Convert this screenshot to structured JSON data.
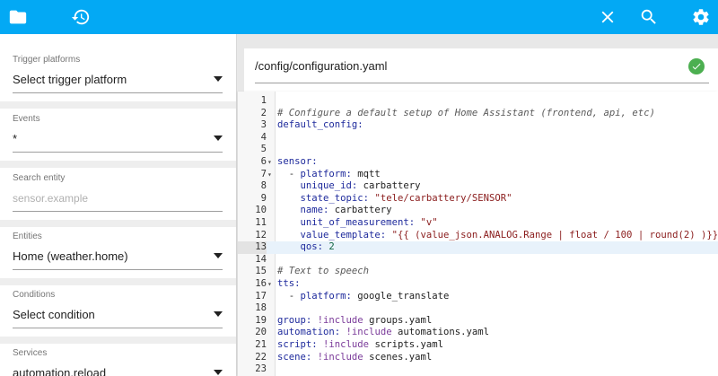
{
  "toolbar": {
    "icons": [
      "folder-icon",
      "history-icon",
      "close-icon",
      "search-icon",
      "settings-icon"
    ],
    "color": "#03a9f4"
  },
  "sidebar": {
    "trigger_platforms": {
      "label": "Trigger platforms",
      "value": "Select trigger platform"
    },
    "events": {
      "label": "Events",
      "value": "*"
    },
    "search_entity": {
      "label": "Search entity",
      "placeholder": "sensor.example"
    },
    "entities": {
      "label": "Entities",
      "value": "Home (weather.home)"
    },
    "conditions": {
      "label": "Conditions",
      "value": "Select condition"
    },
    "services": {
      "label": "Services",
      "value": "automation.reload"
    }
  },
  "editor": {
    "file_path": "/config/configuration.yaml",
    "status": "saved-ok",
    "active_line": 13,
    "lines": [
      {
        "n": "1",
        "fold": "",
        "segs": []
      },
      {
        "n": "2",
        "fold": "",
        "segs": [
          [
            "c-comment",
            "# Configure a default setup of Home Assistant (frontend, api, etc)"
          ]
        ]
      },
      {
        "n": "3",
        "fold": "",
        "segs": [
          [
            "c-key",
            "default_config:"
          ]
        ]
      },
      {
        "n": "4",
        "fold": "",
        "segs": []
      },
      {
        "n": "5",
        "fold": "",
        "segs": []
      },
      {
        "n": "6",
        "fold": "▾",
        "segs": [
          [
            "c-key",
            "sensor:"
          ]
        ]
      },
      {
        "n": "7",
        "fold": "▾",
        "segs": [
          [
            "c-dash",
            "  - "
          ],
          [
            "c-key",
            "platform:"
          ],
          [
            "",
            " mqtt"
          ]
        ]
      },
      {
        "n": "8",
        "fold": "",
        "segs": [
          [
            "",
            "    "
          ],
          [
            "c-key",
            "unique_id:"
          ],
          [
            "",
            " carbattery"
          ]
        ]
      },
      {
        "n": "9",
        "fold": "",
        "segs": [
          [
            "",
            "    "
          ],
          [
            "c-key",
            "state_topic:"
          ],
          [
            "c-str",
            " \"tele/carbattery/SENSOR\""
          ]
        ]
      },
      {
        "n": "10",
        "fold": "",
        "segs": [
          [
            "",
            "    "
          ],
          [
            "c-key",
            "name:"
          ],
          [
            "",
            " carbattery"
          ]
        ]
      },
      {
        "n": "11",
        "fold": "",
        "segs": [
          [
            "",
            "    "
          ],
          [
            "c-key",
            "unit_of_measurement:"
          ],
          [
            "c-str",
            " \"v\""
          ]
        ]
      },
      {
        "n": "12",
        "fold": "",
        "segs": [
          [
            "",
            "    "
          ],
          [
            "c-key",
            "value_template:"
          ],
          [
            "c-str",
            " \"{{ (value_json.ANALOG.Range | float / 100 | round(2) )}}\""
          ]
        ]
      },
      {
        "n": "13",
        "fold": "",
        "segs": [
          [
            "",
            "    "
          ],
          [
            "c-key",
            "qos:"
          ],
          [
            "c-num",
            " 2"
          ]
        ]
      },
      {
        "n": "14",
        "fold": "",
        "segs": []
      },
      {
        "n": "15",
        "fold": "",
        "segs": [
          [
            "c-comment",
            "# Text to speech"
          ]
        ]
      },
      {
        "n": "16",
        "fold": "▾",
        "segs": [
          [
            "c-key",
            "tts:"
          ]
        ]
      },
      {
        "n": "17",
        "fold": "",
        "segs": [
          [
            "c-dash",
            "  - "
          ],
          [
            "c-key",
            "platform:"
          ],
          [
            "",
            " google_translate"
          ]
        ]
      },
      {
        "n": "18",
        "fold": "",
        "segs": []
      },
      {
        "n": "19",
        "fold": "",
        "segs": [
          [
            "c-key",
            "group:"
          ],
          [
            "c-tag",
            " !include"
          ],
          [
            "",
            " groups.yaml"
          ]
        ]
      },
      {
        "n": "20",
        "fold": "",
        "segs": [
          [
            "c-key",
            "automation:"
          ],
          [
            "c-tag",
            " !include"
          ],
          [
            "",
            " automations.yaml"
          ]
        ]
      },
      {
        "n": "21",
        "fold": "",
        "segs": [
          [
            "c-key",
            "script:"
          ],
          [
            "c-tag",
            " !include"
          ],
          [
            "",
            " scripts.yaml"
          ]
        ]
      },
      {
        "n": "22",
        "fold": "",
        "segs": [
          [
            "c-key",
            "scene:"
          ],
          [
            "c-tag",
            " !include"
          ],
          [
            "",
            " scenes.yaml"
          ]
        ]
      },
      {
        "n": "23",
        "fold": "",
        "segs": []
      }
    ]
  }
}
